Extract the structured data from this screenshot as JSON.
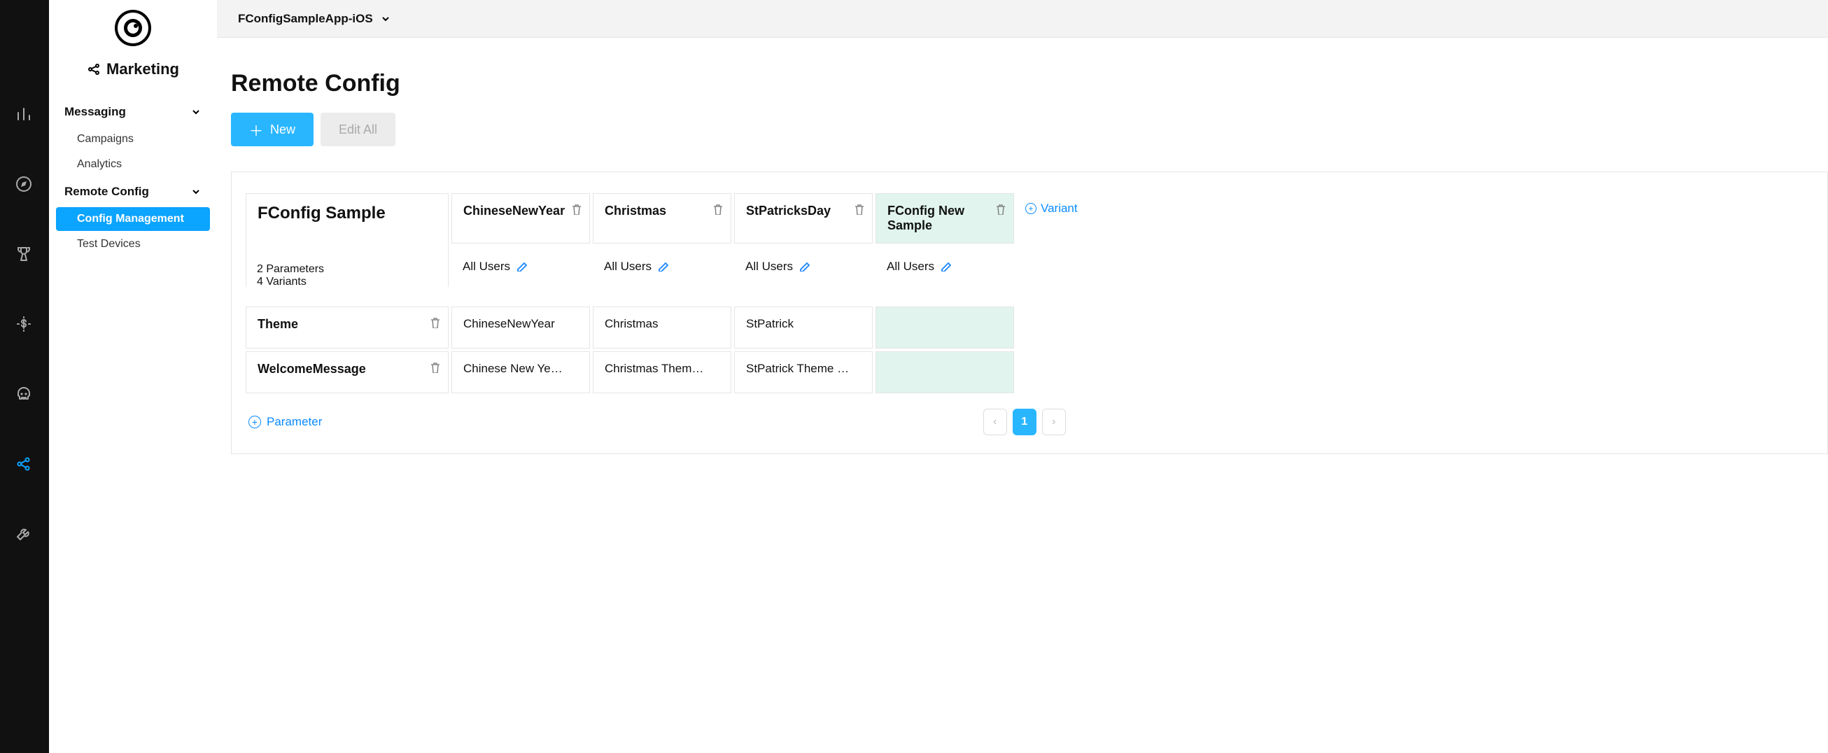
{
  "brand": {
    "title": "Marketing"
  },
  "nav": {
    "sections": [
      {
        "label": "Messaging",
        "items": [
          {
            "label": "Campaigns"
          },
          {
            "label": "Analytics"
          }
        ]
      },
      {
        "label": "Remote Config",
        "items": [
          {
            "label": "Config Management",
            "active": true
          },
          {
            "label": "Test Devices"
          }
        ]
      }
    ]
  },
  "topbar": {
    "app_name": "FConfigSampleApp-iOS"
  },
  "page": {
    "title": "Remote Config"
  },
  "actions": {
    "new_label": "New",
    "editall_label": "Edit All"
  },
  "config": {
    "name": "FConfig Sample",
    "summary_params": "2 Parameters",
    "summary_variants": "4 Variants",
    "variants": [
      {
        "name": "ChineseNewYear",
        "audience": "All Users",
        "new": false
      },
      {
        "name": "Christmas",
        "audience": "All Users",
        "new": false
      },
      {
        "name": "StPatricksDay",
        "audience": "All Users",
        "new": false
      },
      {
        "name": "FConfig New Sample",
        "audience": "All Users",
        "new": true
      }
    ],
    "params": [
      {
        "name": "Theme",
        "values": [
          "ChineseNewYear",
          "Christmas",
          "StPatrick",
          ""
        ]
      },
      {
        "name": "WelcomeMessage",
        "values": [
          "Chinese New Year The…",
          "Christmas Theme Fetc…",
          "StPatrick Theme Fetc…",
          ""
        ]
      }
    ]
  },
  "footer": {
    "add_parameter": "Parameter",
    "add_variant": "Variant",
    "page_current": "1"
  }
}
